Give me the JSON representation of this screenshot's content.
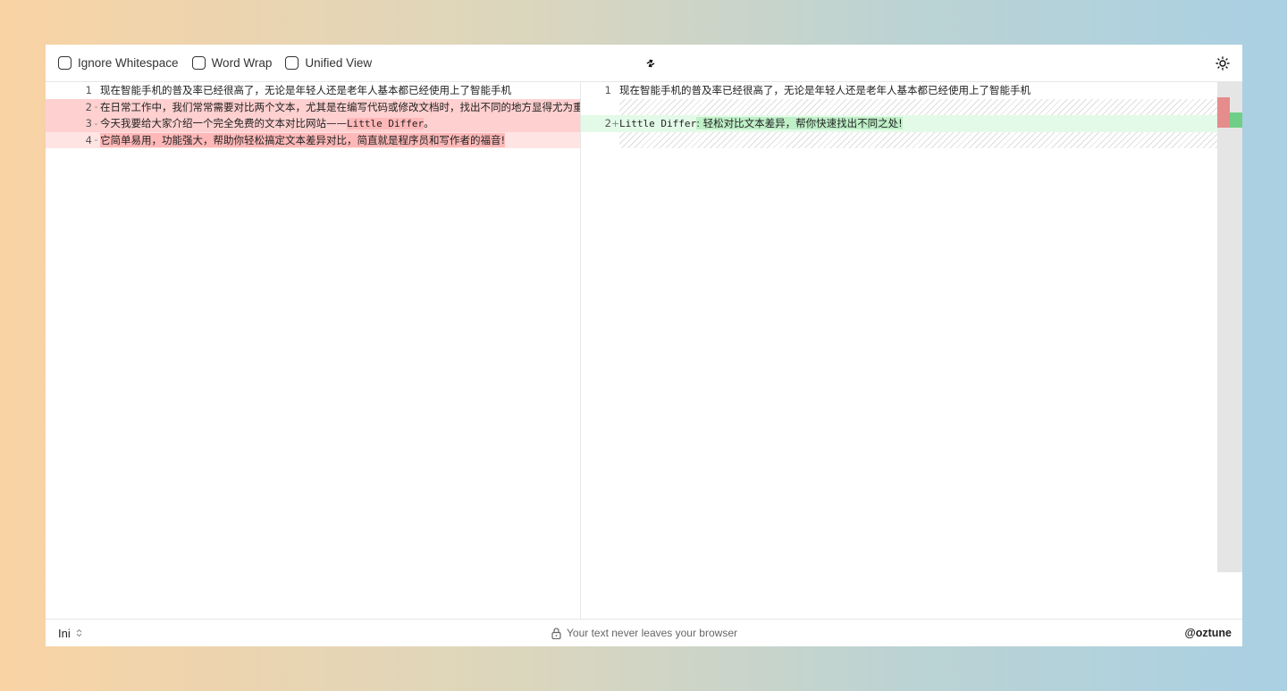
{
  "toolbar": {
    "options": [
      {
        "label": "Ignore Whitespace",
        "checked": false
      },
      {
        "label": "Word Wrap",
        "checked": false
      },
      {
        "label": "Unified View",
        "checked": false
      }
    ],
    "swap_icon": "swap-arrows-icon",
    "theme_icon": "sun-icon"
  },
  "left_pane": {
    "lines": [
      {
        "num": "1",
        "mark": "",
        "text": "现在智能手机的普及率已经很高了，无论是年轻人还是老年人基本都已经使用上了智能手机",
        "type": "same"
      },
      {
        "num": "2",
        "mark": "-",
        "text": "在日常工作中，我们常常需要对比两个文本，尤其是在编写代码或修改文档时，找出不同的地方显得尤为重要。",
        "type": "del"
      },
      {
        "num": "3",
        "mark": "-",
        "text_a": "今天我要给大家介绍一个完全免费的文本对比网站——",
        "text_mono": "Little Differ",
        "text_b": "。",
        "type": "del"
      },
      {
        "num": "4",
        "mark": "-",
        "text": "它简单易用，功能强大，帮助你轻松搞定文本差异对比，简直就是程序员和写作者的福音!",
        "type": "del-light"
      }
    ]
  },
  "right_pane": {
    "lines": [
      {
        "num": "1",
        "mark": "",
        "text": "现在智能手机的普及率已经很高了，无论是年轻人还是老年人基本都已经使用上了智能手机",
        "type": "same"
      },
      {
        "num": "2",
        "mark": "+",
        "text_mono": "Little Differ",
        "text_a": ": 轻松对比文本差异，帮你快速找出不同之处!",
        "type": "add"
      }
    ]
  },
  "footer": {
    "language": "Ini",
    "privacy_text": "Your text never leaves your browser",
    "handle": "@oztune"
  },
  "colors": {
    "deletion": "#ffd0d0",
    "addition": "#e4fae8",
    "minimap_del": "#e58c8c",
    "minimap_add": "#6fcf87"
  }
}
